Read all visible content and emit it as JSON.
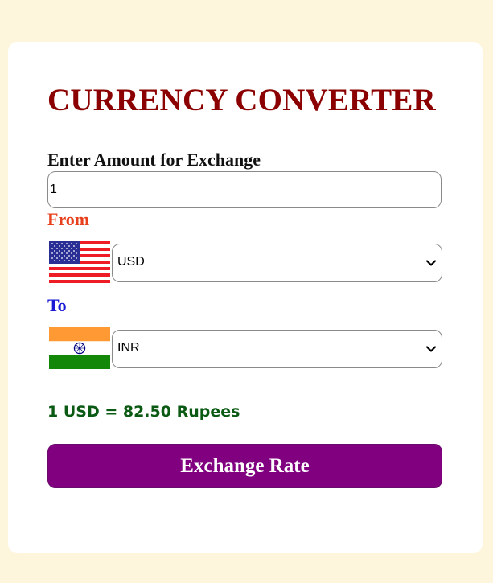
{
  "title": "CURRENCY CONVERTER",
  "amount": {
    "label": "Enter Amount for Exchange",
    "value": "1"
  },
  "from": {
    "label": "From",
    "flag": "us-flag",
    "selected": "USD"
  },
  "to": {
    "label": "To",
    "flag": "india-flag",
    "selected": "INR"
  },
  "result": "1 USD = 82.50 Rupees",
  "button_label": "Exchange Rate",
  "colors": {
    "page_background": "#fdf6dc",
    "title": "#8b0000",
    "from_label": "#e8401c",
    "to_label": "#1a1ad6",
    "result": "#0b5a14",
    "button": "#800080"
  }
}
